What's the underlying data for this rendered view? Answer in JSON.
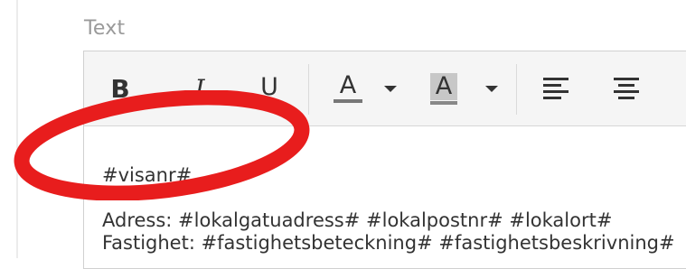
{
  "field": {
    "label": "Text"
  },
  "toolbar": {
    "bold_label": "B",
    "italic_label": "I",
    "underline_label": "U",
    "font_color_label": "A",
    "background_color_label": "A"
  },
  "content": {
    "lines": [
      "#visanr#",
      "Adress: #lokalgatuadress# #lokalpostnr# #lokalort#",
      "Fastighet: #fastighetsbeteckning# #fastighetsbeskrivning#"
    ]
  },
  "annotation": {
    "shape": "ellipse",
    "color": "#e81d1d"
  }
}
